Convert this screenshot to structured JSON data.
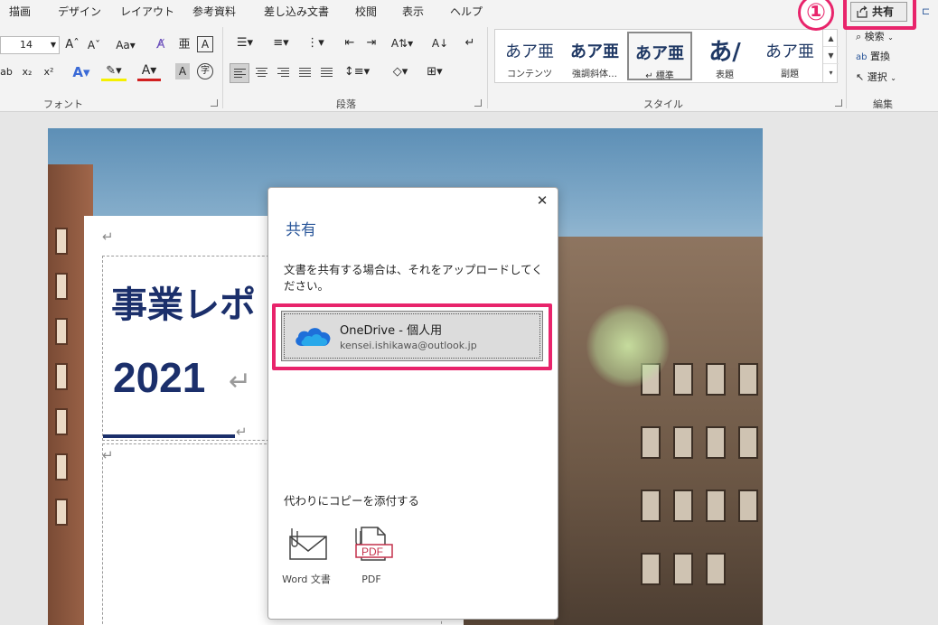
{
  "ribbon": {
    "tabs": [
      "描画",
      "デザイン",
      "レイアウト",
      "参考資料",
      "差し込み文書",
      "校閲",
      "表示",
      "ヘルプ"
    ],
    "font_size": "14",
    "groups": {
      "font": "フォント",
      "paragraph": "段落",
      "styles": "スタイル",
      "editing": "編集"
    },
    "styles": [
      {
        "preview": "あア亜",
        "name": "コンテンツ"
      },
      {
        "preview": "あア亜",
        "name": "強調斜体…"
      },
      {
        "preview": "あア亜",
        "name": "↵ 標準"
      },
      {
        "preview": "あ/",
        "name": "表題"
      },
      {
        "preview": "あア亜",
        "name": "副題"
      }
    ],
    "editing": {
      "find": "検索",
      "replace": "置換",
      "select": "選択"
    },
    "share_label": "共有",
    "step_marker": "①",
    "accent_color": "#e8246b",
    "brand_color": "#2b579a"
  },
  "document": {
    "title": "事業レポ",
    "year": "2021"
  },
  "dialog": {
    "title": "共有",
    "description": "文書を共有する場合は、それをアップロードしてください。",
    "onedrive_name": "OneDrive - 個人用",
    "onedrive_email": "kensei.ishikawa@outlook.jp",
    "attach_label": "代わりにコピーを添付する",
    "attach_word": "Word 文書",
    "attach_pdf": "PDF",
    "pdf_badge": "PDF",
    "close_icon": "close-icon"
  }
}
